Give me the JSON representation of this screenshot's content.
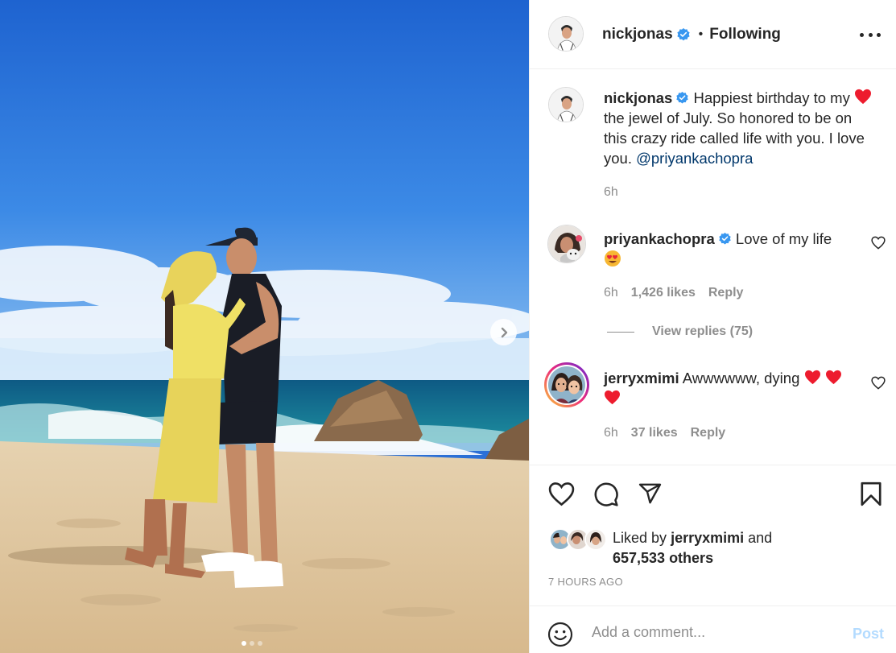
{
  "post": {
    "author": "nickjonas",
    "follow_status": "Following",
    "separator": "•",
    "image_alt": "Couple kissing on a sunny beach",
    "carousel_count": 3,
    "carousel_active": 1
  },
  "caption": {
    "username": "nickjonas",
    "text_before": "Happiest birthday to my",
    "text_after": "the jewel of July. So honored to be on this crazy ride called life with you. I love you.",
    "mention": "@priyankachopra",
    "time": "6h"
  },
  "comments": [
    {
      "username": "priyankachopra",
      "text": "Love of my life",
      "emoji": "heart-eyes",
      "time": "6h",
      "likes": "1,426 likes",
      "reply_label": "Reply",
      "view_replies": "View replies (75)"
    },
    {
      "username": "jerryxmimi",
      "text": "Awwwwww, dying",
      "emoji": "red-hearts",
      "time": "6h",
      "likes": "37 likes",
      "reply_label": "Reply"
    }
  ],
  "likes": {
    "prefix": "Liked by",
    "user": "jerryxmimi",
    "conjunction": "and",
    "others": "657,533 others"
  },
  "timestamp": "7 HOURS AGO",
  "composer": {
    "placeholder": "Add a comment...",
    "post_label": "Post"
  },
  "colors": {
    "verified": "#3897f0",
    "heart_red": "#ed4956",
    "mention": "#00376b",
    "post_disabled": "#b3dbff",
    "muted": "#8e8e8e"
  },
  "icons": [
    "verified-icon",
    "more-icon",
    "heart-icon",
    "comment-icon",
    "share-icon",
    "bookmark-icon",
    "emoji-icon",
    "chevron-right-icon"
  ]
}
